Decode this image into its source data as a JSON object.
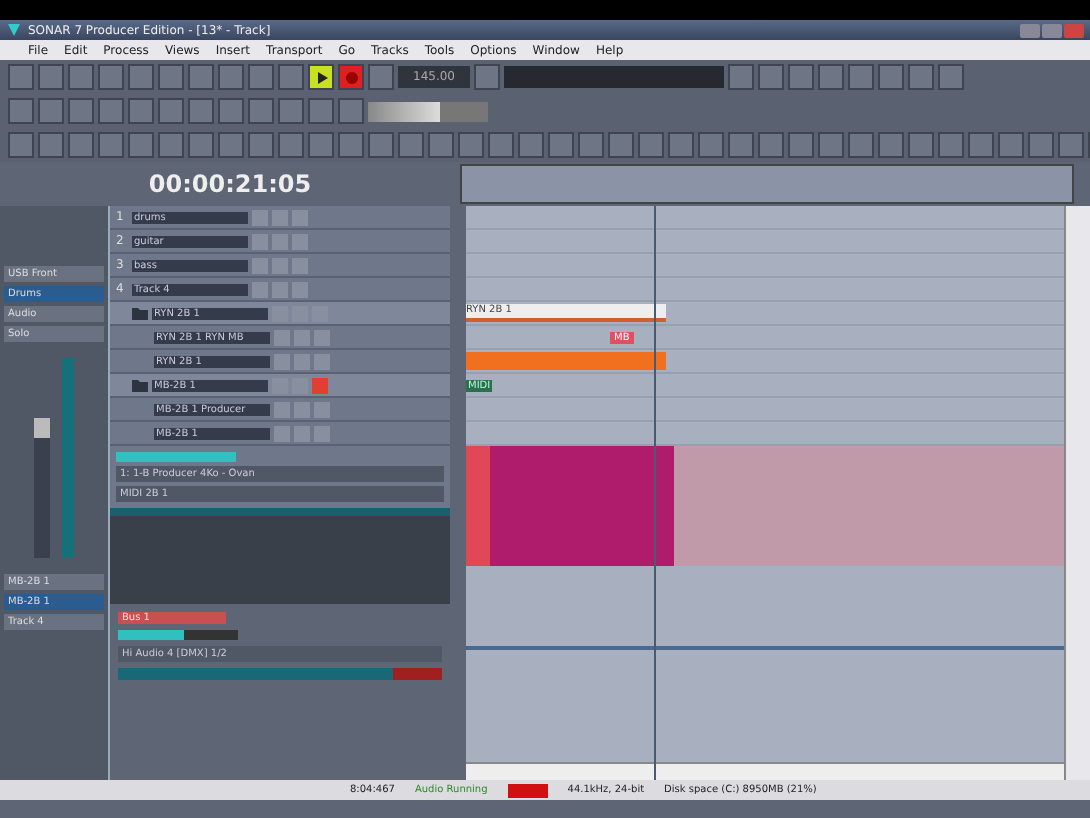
{
  "window": {
    "title": "SONAR 7 Producer Edition - [13* - Track]"
  },
  "menu": [
    "File",
    "Edit",
    "Process",
    "Views",
    "Insert",
    "Transport",
    "Go",
    "Tracks",
    "Tools",
    "Options",
    "Window",
    "Help"
  ],
  "transport": {
    "tempo": "145.00",
    "playing": true,
    "recording": true
  },
  "time": "00:00:21:05",
  "tracks": [
    {
      "number": "1",
      "name": "drums",
      "kind": "track",
      "armed": false
    },
    {
      "number": "2",
      "name": "guitar",
      "kind": "track",
      "armed": false
    },
    {
      "number": "3",
      "name": "bass",
      "kind": "track",
      "armed": false
    },
    {
      "number": "4",
      "name": "Track 4",
      "kind": "track",
      "armed": false
    },
    {
      "name": "RYN 2B 1",
      "kind": "folder",
      "armed": false,
      "clip": {
        "kind": "outline",
        "label": "RYN 2B 1"
      }
    },
    {
      "name": "RYN 2B 1 RYN MB",
      "kind": "sub",
      "armed": false,
      "clip": {
        "kind": "tag",
        "label": "MB"
      }
    },
    {
      "name": "RYN 2B 1",
      "kind": "sub",
      "armed": false,
      "clip": {
        "kind": "bar"
      }
    },
    {
      "name": "MB-2B 1",
      "kind": "folder",
      "armed": true,
      "clip": {
        "kind": "note",
        "label": "MIDI"
      }
    },
    {
      "name": "MB-2B 1 Producer",
      "kind": "sub",
      "armed": false
    },
    {
      "name": "MB-2B 1",
      "kind": "sub",
      "armed": false
    }
  ],
  "zoom": {
    "level": 0.6
  },
  "strip": {
    "input": "1: 1-B Producer 4Ko - Ovan",
    "output": "MIDI 2B 1"
  },
  "inspector": {
    "items": [
      "USB Front",
      "Drums",
      "Audio",
      "Solo"
    ],
    "bottom": [
      "MB-2B 1",
      "MB-2B 1",
      "Track 4"
    ]
  },
  "bus": {
    "name": "Bus 1",
    "output": "Hi Audio 4 [DMX] 1/2",
    "level": 0.55
  },
  "status": {
    "time": "8:04:467",
    "state": "Audio Running",
    "format": "44.1kHz, 24-bit",
    "disk": "Disk space (C:) 8950MB (21%)"
  }
}
